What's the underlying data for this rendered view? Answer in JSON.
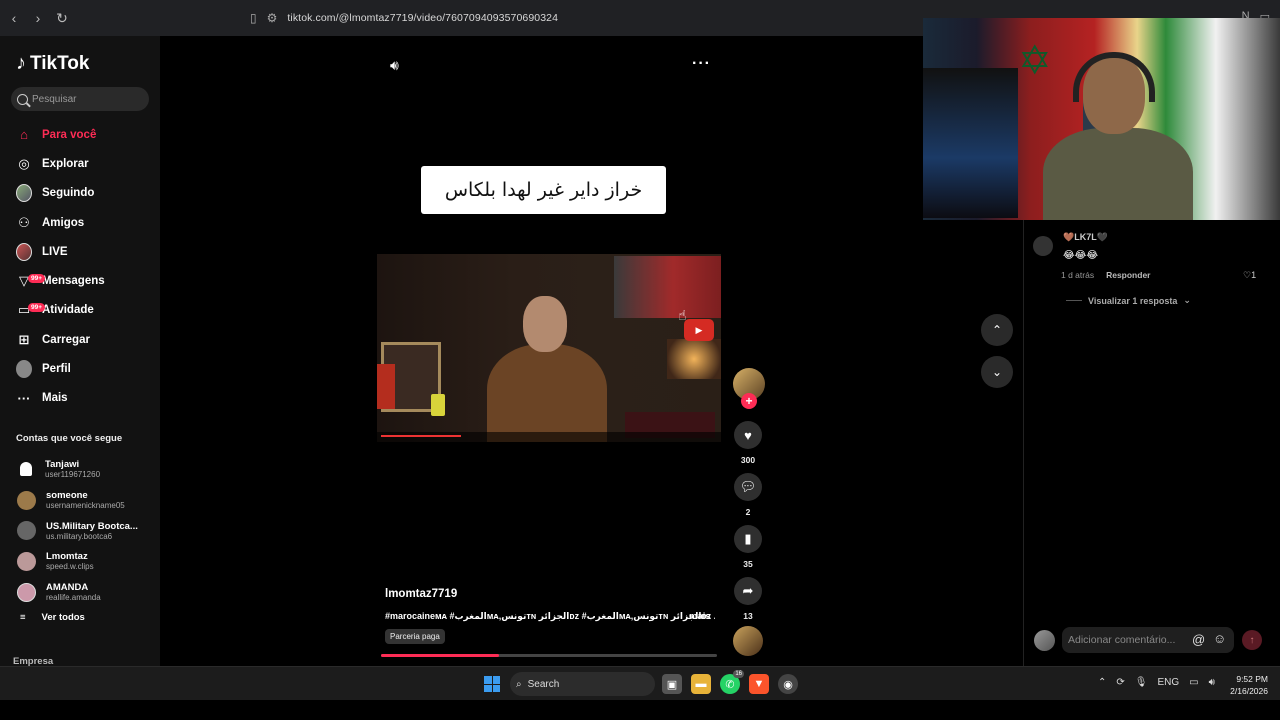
{
  "browser": {
    "url": "tiktok.com/@lmomtaz7719/video/7607094093570690324"
  },
  "sidebar": {
    "logo": "TikTok",
    "search_placeholder": "Pesquisar",
    "menu": [
      {
        "label": "Para você",
        "icon": "home-icon",
        "active": true
      },
      {
        "label": "Explorar",
        "icon": "compass-icon"
      },
      {
        "label": "Seguindo",
        "icon": "following-avatar-icon"
      },
      {
        "label": "Amigos",
        "icon": "friends-icon"
      },
      {
        "label": "LIVE",
        "icon": "live-icon"
      },
      {
        "label": "Mensagens",
        "icon": "messages-icon",
        "badge": "99+"
      },
      {
        "label": "Atividade",
        "icon": "activity-icon",
        "badge": "99+"
      },
      {
        "label": "Carregar",
        "icon": "upload-icon"
      },
      {
        "label": "Perfil",
        "icon": "profile-avatar-icon"
      },
      {
        "label": "Mais",
        "icon": "more-icon"
      }
    ],
    "following_title": "Contas que você segue",
    "following": [
      {
        "name": "Tanjawi",
        "handle": "user119671260"
      },
      {
        "name": "someone",
        "handle": "usernamenickname05"
      },
      {
        "name": "US.Military Bootca...",
        "handle": "us.military.bootca6"
      },
      {
        "name": "Lmomtaz",
        "handle": "speed.w.clips"
      },
      {
        "name": "AMANDA",
        "handle": "reallife.amanda"
      }
    ],
    "see_all": "Ver todos",
    "footer": "Empresa"
  },
  "video": {
    "caption_overlay": "خراز داير غير لهدا بلكاس",
    "author": "lmomtaz7719",
    "description": "#marocaineᴍᴀ #المغربᴍᴀ,تونسᴛɴ الجزائرᴅᴢ #المغربᴍᴀ,تونسᴛɴ الجزائرᴅᴢ ...",
    "more": "mais",
    "paid_label": "Parceria paga",
    "progress": 0.35
  },
  "actions": {
    "likes": "300",
    "comments": "2",
    "saves": "35",
    "shares": "13"
  },
  "comments": {
    "item": {
      "user": "🤎LK7L🖤",
      "text": "😂😂😂",
      "time": "1 d atrás",
      "reply": "Responder",
      "likes": "1"
    },
    "view_replies": "Visualizar 1 resposta",
    "input_placeholder": "Adicionar comentário..."
  },
  "taskbar": {
    "search": "Search",
    "whatsapp_badge": "16",
    "lang": "ENG",
    "time": "9:52 PM",
    "date": "2/16/2026"
  },
  "colors": {
    "accent": "#fe2c55",
    "sidebar_bg": "#121212",
    "browser_bg": "#202124"
  }
}
